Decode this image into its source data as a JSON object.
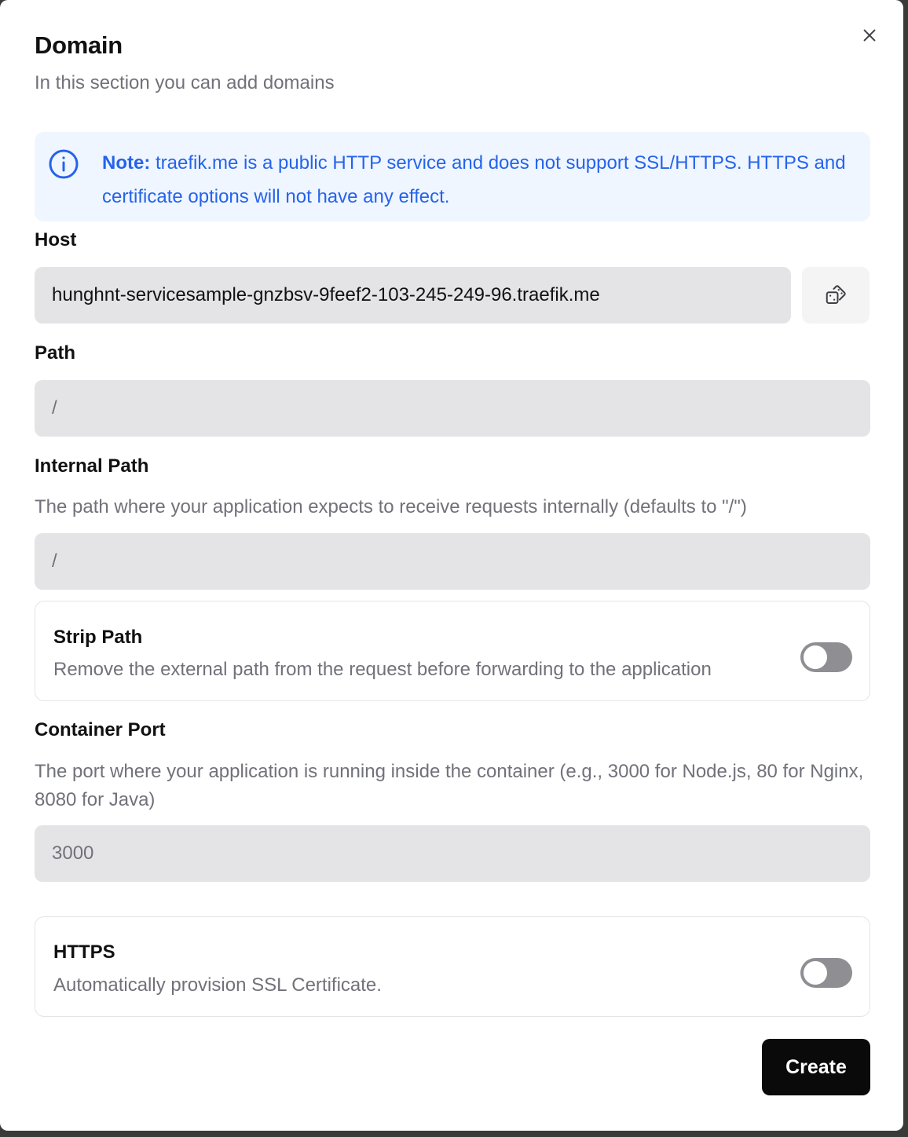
{
  "dialog": {
    "title": "Domain",
    "subtitle": "In this section you can add domains",
    "close_icon": "x-icon"
  },
  "note": {
    "icon": "info-icon",
    "prefix": "Note:",
    "text": " traefik.me is a public HTTP service and does not support SSL/HTTPS. HTTPS and certificate options will not have any effect.",
    "color": "#2563eb",
    "background": "#eff6ff"
  },
  "host": {
    "label": "Host",
    "value": "hunghnt-servicesample-gnzbsv-9feef2-103-245-249-96.traefik.me",
    "generate_icon": "dice-icon"
  },
  "path": {
    "label": "Path",
    "placeholder": "/"
  },
  "internal_path": {
    "label": "Internal Path",
    "description": "The path where your application expects to receive requests internally (defaults to \"/\")",
    "placeholder": "/"
  },
  "strip_path": {
    "title": "Strip Path",
    "description": "Remove the external path from the request before forwarding to the application",
    "enabled": false
  },
  "container_port": {
    "label": "Container Port",
    "description": "The port where your application is running inside the container (e.g., 3000 for Node.js, 80 for Nginx, 8080 for Java)",
    "placeholder": "3000"
  },
  "https": {
    "title": "HTTPS",
    "description": "Automatically provision SSL Certificate.",
    "enabled": false
  },
  "actions": {
    "create_label": "Create"
  }
}
